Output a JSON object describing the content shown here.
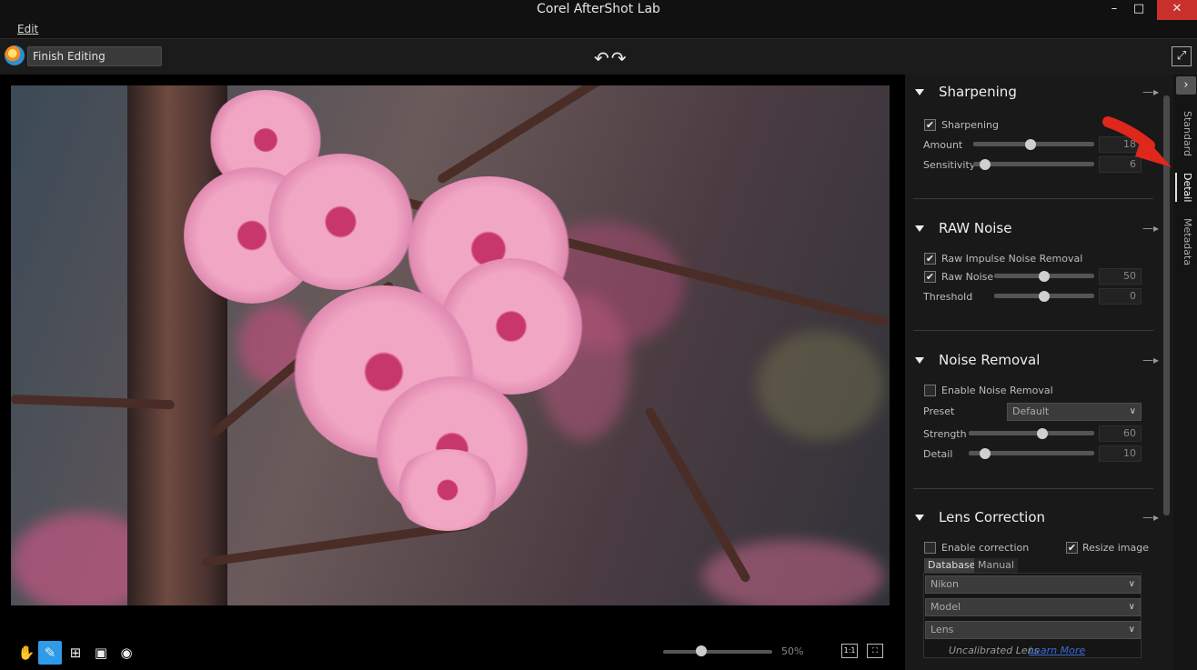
{
  "window": {
    "title": "Corel AfterShot Lab",
    "minimize": "–",
    "maximize": "□",
    "close": "✕"
  },
  "menu": {
    "edit": "Edit"
  },
  "toolbar": {
    "finish_editing": "Finish Editing",
    "undo_redo": "↶↷",
    "expand": "⤢"
  },
  "bottom": {
    "zoom_label": "50%",
    "zoom_level": 0.35,
    "fit_1to1": "1:1",
    "fit_screen": "⛶",
    "tools": [
      "hand-icon",
      "eyedropper-icon",
      "crop-icon",
      "image-icon",
      "eye-icon"
    ]
  },
  "sidetabs": {
    "standard": "Standard",
    "detail": "Detail",
    "metadata": "Metadata",
    "toggle": "›"
  },
  "sharpening": {
    "title": "Sharpening",
    "enable_label": "Sharpening",
    "enabled": true,
    "amount_label": "Amount",
    "amount_value": "18",
    "sensitivity_label": "Sensitivity",
    "sensitivity_value": "6"
  },
  "raw_noise": {
    "title": "RAW Noise",
    "impulse_label": "Raw Impulse Noise Removal",
    "raw_noise_label": "Raw Noise",
    "raw_noise_value": "50",
    "threshold_label": "Threshold",
    "threshold_value": "0"
  },
  "noise_removal": {
    "title": "Noise Removal",
    "enable_label": "Enable Noise Removal",
    "preset_label": "Preset",
    "preset_value": "Default",
    "strength_label": "Strength",
    "strength_value": "60",
    "detail_label": "Detail",
    "detail_value": "10"
  },
  "lens_correction": {
    "title": "Lens Correction",
    "enable_label": "Enable correction",
    "resize_label": "Resize image",
    "tab_database": "Database",
    "tab_manual": "Manual",
    "make": "Nikon",
    "model": "Model",
    "lens": "Lens",
    "uncalibrated": "Uncalibrated Lens",
    "learn_more": "Learn More"
  },
  "icons": {
    "pin": "—▸",
    "checkmark": "✔",
    "chevron": "∨"
  },
  "colors": {
    "accent": "#2e9be8",
    "close_red": "#c9302c",
    "annotation_red": "#e0271b"
  }
}
